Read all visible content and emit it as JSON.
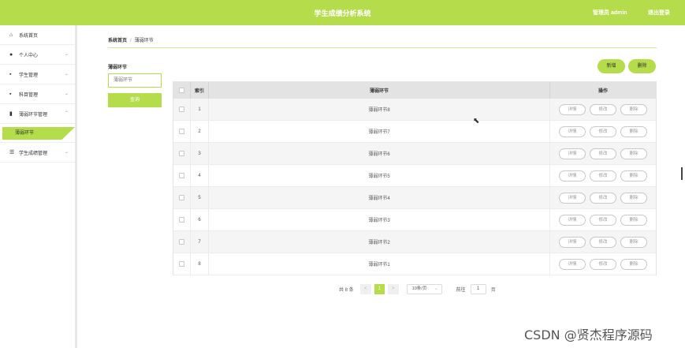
{
  "header": {
    "title": "学生成绩分析系统",
    "user_label": "管理员 admin",
    "logout_label": "退出登录",
    "accent_color": "#b5dc4b"
  },
  "sidebar": {
    "items": [
      {
        "label": "系统首页",
        "icon": "home-icon"
      },
      {
        "label": "个人中心",
        "icon": "user-icon"
      },
      {
        "label": "学生管理",
        "icon": "grid-icon"
      },
      {
        "label": "科目管理",
        "icon": "grid-icon"
      },
      {
        "label": "薄弱环节管理",
        "icon": "bar-chart-icon"
      },
      {
        "label": "学生成绩管理",
        "icon": "list-icon"
      }
    ],
    "active_sub_item": "薄弱环节"
  },
  "breadcrumb": {
    "home": "系统首页",
    "separator": "/",
    "current": "薄弱环节"
  },
  "filter": {
    "label": "薄弱环节",
    "placeholder": "薄弱环节",
    "search_label": "查询"
  },
  "actions": {
    "add_label": "新增",
    "delete_label": "删除"
  },
  "table": {
    "columns": [
      "索引",
      "薄弱环节",
      "操作"
    ],
    "op_labels": {
      "detail": "详情",
      "edit": "修改",
      "delete": "删除"
    },
    "rows": [
      {
        "index": "1",
        "name": "薄弱环节8"
      },
      {
        "index": "2",
        "name": "薄弱环节7"
      },
      {
        "index": "3",
        "name": "薄弱环节6"
      },
      {
        "index": "4",
        "name": "薄弱环节5"
      },
      {
        "index": "5",
        "name": "薄弱环节4"
      },
      {
        "index": "6",
        "name": "薄弱环节3"
      },
      {
        "index": "7",
        "name": "薄弱环节2"
      },
      {
        "index": "8",
        "name": "薄弱环节1"
      }
    ]
  },
  "pagination": {
    "total": "共 8 条",
    "prev": "<",
    "current_page": "1",
    "next": ">",
    "page_size": "10条/页",
    "goto_label": "前往",
    "goto_value": "1",
    "page_suffix": "页"
  },
  "watermark": "CSDN @贤杰程序源码"
}
